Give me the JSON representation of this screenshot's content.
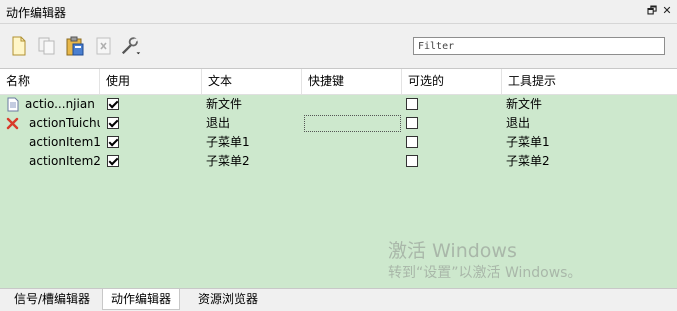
{
  "window": {
    "title": "动作编辑器",
    "float_glyph": "🗗",
    "close_glyph": "✕"
  },
  "toolbar": {
    "tools": [
      {
        "name": "new-action-icon",
        "enabled": true
      },
      {
        "name": "copy-action-icon",
        "enabled": false
      },
      {
        "name": "paste-action-icon",
        "enabled": true
      },
      {
        "name": "delete-action-icon",
        "enabled": false
      },
      {
        "name": "configure-icon",
        "enabled": true
      }
    ],
    "filter_placeholder": "Filter"
  },
  "table": {
    "headers": [
      "名称",
      "使用",
      "文本",
      "快捷键",
      "可选的",
      "工具提示"
    ],
    "rows": [
      {
        "name": "actio...njian",
        "icon": "document-icon",
        "used": true,
        "text": "新文件",
        "shortcut": "",
        "checkable": false,
        "tooltip": "新文件"
      },
      {
        "name": "actionTuichu",
        "icon": "red-x-icon",
        "used": true,
        "text": "退出",
        "shortcut": "",
        "checkable": false,
        "tooltip": "退出"
      },
      {
        "name": "actionItem1",
        "icon": "",
        "used": true,
        "text": "子菜单1",
        "shortcut": "",
        "checkable": false,
        "tooltip": "子菜单1"
      },
      {
        "name": "actionItem2",
        "icon": "",
        "used": true,
        "text": "子菜单2",
        "shortcut": "",
        "checkable": false,
        "tooltip": "子菜单2"
      }
    ]
  },
  "watermark": {
    "line1": "激活 Windows",
    "line2": "转到“设置”以激活 Windows。"
  },
  "tabs": [
    {
      "label": "信号/槽编辑器",
      "active": false
    },
    {
      "label": "动作编辑器",
      "active": true
    },
    {
      "label": "资源浏览器",
      "active": false
    }
  ],
  "colors": {
    "table_bg": "#cde8cd",
    "header_bg": "#ffffff"
  }
}
